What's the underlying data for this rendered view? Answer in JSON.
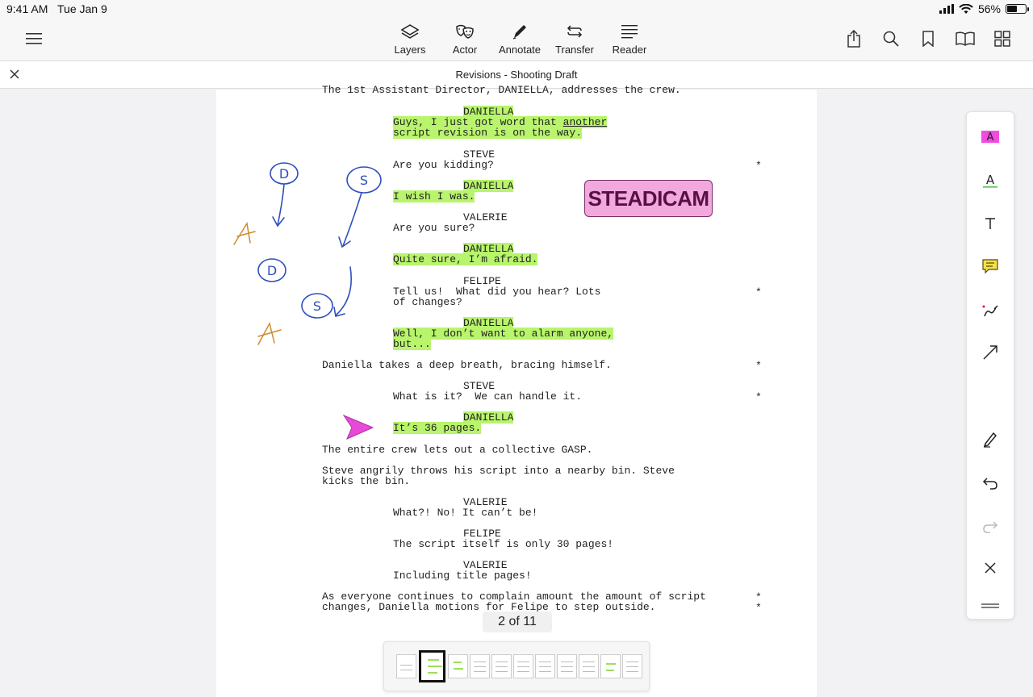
{
  "status": {
    "time": "9:41 AM",
    "date": "Tue Jan 9",
    "battery": "56%",
    "battery_level": 0.56
  },
  "toolbar": {
    "tools": [
      {
        "label": "Layers",
        "icon": "layers-icon"
      },
      {
        "label": "Actor",
        "icon": "theater-masks-icon"
      },
      {
        "label": "Annotate",
        "icon": "pen-icon"
      },
      {
        "label": "Transfer",
        "icon": "transfer-icon"
      },
      {
        "label": "Reader",
        "icon": "reader-lines-icon"
      }
    ],
    "right_icons": [
      "share-icon",
      "search-icon",
      "bookmark-icon",
      "book-icon",
      "grid-icon"
    ]
  },
  "document": {
    "title": "Revisions - Shooting Draft",
    "lines": {
      "l0": "The 1st Assistant Director, DANIELLA, addresses the crew.",
      "c1": "DANIELLA",
      "d1a": "Guys, I just got word that ",
      "d1u": "another",
      "d1b": "script revision is on the way.",
      "c2": "STEVE",
      "d2": "Are you kidding?",
      "c3": "DANIELLA",
      "d3": "I wish I was.",
      "c4": "VALERIE",
      "d4": "Are you sure?",
      "c5": "DANIELLA",
      "d5": "Quite sure, I’m afraid.",
      "c6": "FELIPE",
      "d6a": "Tell us!  What did you hear? Lots",
      "d6b": "of changes?",
      "c7": "DANIELLA",
      "d7a": "Well, I don’t want to alarm anyone,",
      "d7b": "but...",
      "a1": "Daniella takes a deep breath, bracing himself.",
      "c8": "STEVE",
      "d8": "What is it?  We can handle it.",
      "c9": "DANIELLA",
      "d9": "It’s 36 pages.",
      "a2": "The entire crew lets out a collective GASP.",
      "a3a": "Steve angrily throws his script into a nearby bin. Steve",
      "a3b": "kicks the bin.",
      "c10": "VALERIE",
      "d10": "What?! No! It can’t be!",
      "c11": "FELIPE",
      "d11": "The script itself is only 30 pages!",
      "c12": "VALERIE",
      "d12": "Including title pages!",
      "a4a": "As everyone continues to complain amount the amount of script",
      "a4b": "changes, Daniella motions for Felipe to step outside."
    },
    "revision_mark": "*",
    "stamp": "STEADICAM",
    "sketch_letters": [
      "D",
      "S",
      "D",
      "S"
    ]
  },
  "pager": {
    "label": "2 of 11"
  },
  "palette": {
    "icons": [
      "highlighter-icon",
      "underline-icon",
      "text-icon",
      "comment-icon",
      "freehand-icon",
      "arrow-icon",
      "eraser-pen-icon",
      "undo-icon",
      "redo-icon",
      "close-icon",
      "drag-handle-icon"
    ]
  },
  "colors": {
    "highlight": "#b8f46c",
    "ink_blue": "#2f4fbf",
    "ink_orange": "#d08a2c",
    "stamp_bg": "#f1a8dc",
    "pointer": "#e84ad8"
  }
}
